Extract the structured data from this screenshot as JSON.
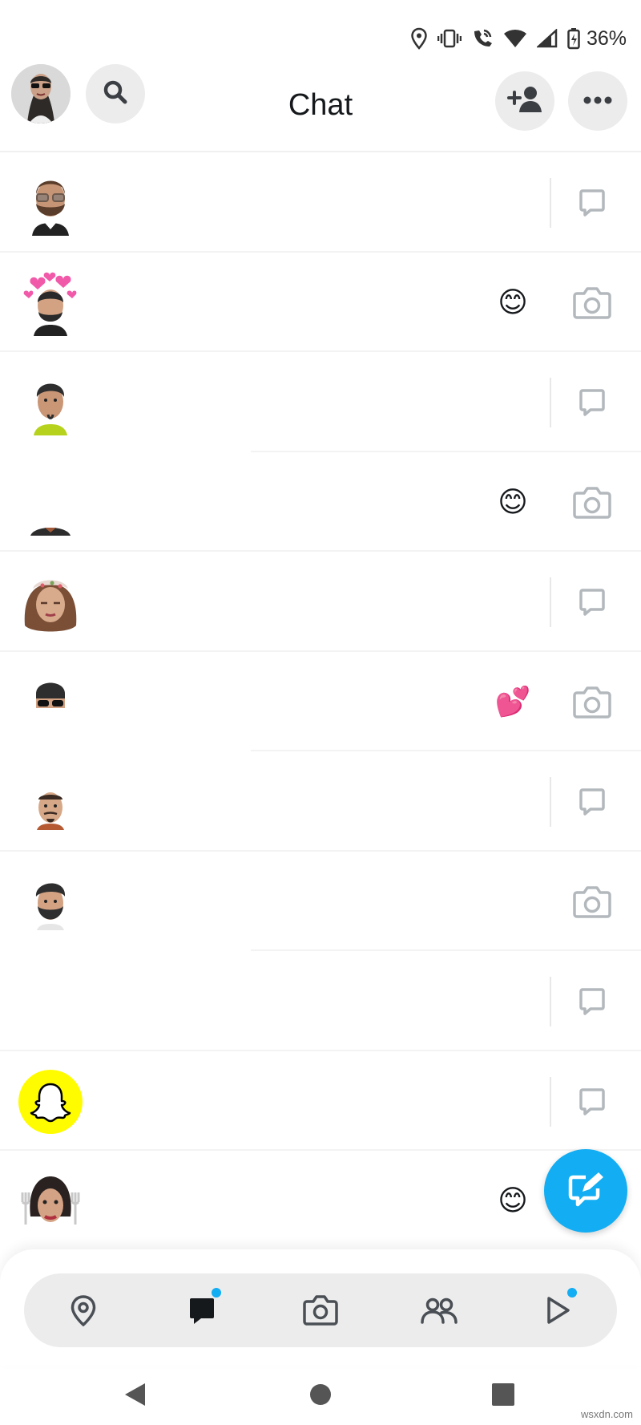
{
  "status_bar": {
    "icons": [
      "location-icon",
      "vibrate-icon",
      "wifi-call-icon",
      "wifi-icon",
      "cell-signal-icon",
      "battery-charging-icon"
    ],
    "battery": "36%"
  },
  "header": {
    "title": "Chat",
    "buttons": [
      "profile-avatar",
      "search-icon",
      "add-friend-icon",
      "more-icon"
    ]
  },
  "colors": {
    "accent": "#12adf2",
    "snap_yellow": "#fffc00",
    "icon_gray": "#b3b8bd",
    "pill_bg": "#ececec"
  },
  "chats": [
    {
      "avatar": "bitmoji-glasses-beard",
      "emoji": "",
      "action": "chat-bubble-icon"
    },
    {
      "avatar": "bitmoji-hearts-crown",
      "emoji": "😊",
      "action": "camera-icon"
    },
    {
      "avatar": "bitmoji-green-shirt",
      "emoji": "",
      "action": "chat-bubble-icon"
    },
    {
      "avatar": "bitmoji-partial",
      "emoji": "😊",
      "action": "camera-icon"
    },
    {
      "avatar": "bitmoji-woman-headband",
      "emoji": "",
      "action": "chat-bubble-icon"
    },
    {
      "avatar": "bitmoji-sunglasses",
      "emoji": "💕",
      "action": "camera-icon"
    },
    {
      "avatar": "bitmoji-goatee",
      "emoji": "",
      "action": "chat-bubble-icon"
    },
    {
      "avatar": "bitmoji-beard",
      "emoji": "",
      "action": "camera-icon"
    },
    {
      "avatar": "none",
      "emoji": "",
      "action": "chat-bubble-icon"
    },
    {
      "avatar": "snapchat-ghost",
      "emoji": "",
      "action": "chat-bubble-icon"
    },
    {
      "avatar": "bitmoji-woman-forks",
      "emoji": "😊",
      "action": "none"
    }
  ],
  "fab": {
    "icon": "compose-chat-icon"
  },
  "bottom_nav": {
    "items": [
      "map-icon",
      "chat-icon",
      "camera-icon",
      "friends-icon",
      "spotlight-icon"
    ],
    "active": "chat-icon",
    "badges": [
      "chat-icon",
      "spotlight-icon"
    ]
  },
  "system_nav": [
    "back-icon",
    "home-icon",
    "recents-icon"
  ],
  "watermark": "wsxdn.com"
}
